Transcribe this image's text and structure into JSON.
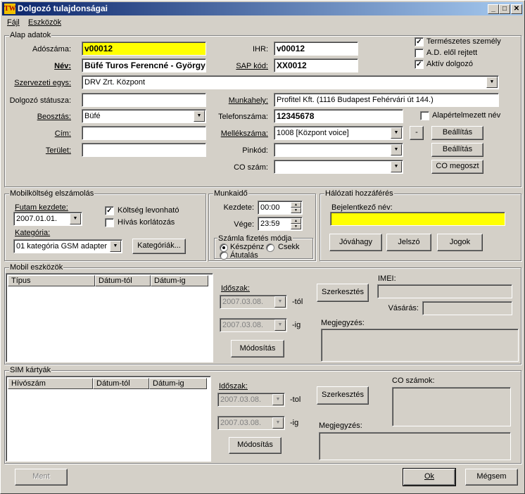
{
  "window": {
    "title": "Dolgozó tulajdonságai",
    "icon_text": "TW",
    "minimize": "_",
    "maximize": "□",
    "close": "✕"
  },
  "menu": {
    "file": "Fájl",
    "tools": "Eszközök"
  },
  "basic": {
    "group_title": "Alap adatok",
    "tax_label": "Adószáma:",
    "tax_value": "v00012",
    "name_label": "Név:",
    "name_value": "Büfé Turos Ferencné - György",
    "ihr_label": "IHR:",
    "ihr_value": "v00012",
    "sap_label": "SAP kód:",
    "sap_value": "XX0012",
    "natural_person": "Természetes személy",
    "ad_hidden": "A.D. elől rejtett",
    "active_employee": "Aktív dolgozó",
    "unit_label": "Szervezeti egys:",
    "unit_value": "DRV Zrt. Központ",
    "status_label": "Dolgozó státusza:",
    "status_value": "",
    "workplace_label": "Munkahely:",
    "workplace_value": "Profitel Kft. (1116 Budapest Fehérvári út 144.)",
    "position_label": "Beosztás:",
    "position_value": "Büfé",
    "phone_label": "Telefonszáma:",
    "phone_value": "12345678",
    "default_name": "Alapértelmezett név",
    "address_label": "Cím:",
    "address_value": "",
    "ext_label": "Mellékszáma:",
    "ext_value": "1008 [Központ voice]",
    "minus_button": "-",
    "settings_button": "Beállítás",
    "area_label": "Terület:",
    "area_value": "",
    "pin_label": "Pinkód:",
    "pin_value": "",
    "settings_button2": "Beállítás",
    "co_label": "CO szám:",
    "co_value": "",
    "co_share_button": "CO megoszt"
  },
  "mobile_cost": {
    "group_title": "Mobilköltség elszámolás",
    "run_label": "Futam kezdete:",
    "run_value": "2007.01.01.",
    "deductible": "Költség levonható",
    "call_limit": "Hívás korlátozás",
    "category_label": "Kategória:",
    "category_value": "01 kategória GSM adapter",
    "categories_button": "Kategóriák..."
  },
  "worktime": {
    "group_title": "Munkaidő",
    "start_label": "Kezdete:",
    "start_value": "00:00",
    "end_label": "Vége:",
    "end_value": "23:59",
    "payment_title": "Számla fizetés módja",
    "cash": "Készpénz",
    "check": "Csekk",
    "transfer": "Átutalás"
  },
  "network": {
    "group_title": "Hálózati hozzáférés",
    "login_label": "Bejelentkező név:",
    "login_value": "",
    "approve_button": "Jóváhagy",
    "password_button": "Jelszó",
    "rights_button": "Jogok"
  },
  "mobile_devices": {
    "group_title": "Mobil eszközök",
    "columns": [
      "Típus",
      "Dátum-tól",
      "Dátum-ig"
    ],
    "period_label": "Időszak:",
    "from_value": "2007.03.08.",
    "from_suffix": "-tól",
    "to_value": "2007.03.08.",
    "to_suffix": "-ig",
    "modify_button": "Módosítás",
    "edit_button": "Szerkesztés",
    "imei_label": "IMEI:",
    "imei_value": "",
    "purchase_label": "Vásárás:",
    "purchase_value": "",
    "note_label": "Megjegyzés:"
  },
  "sim_cards": {
    "group_title": "SIM kártyák",
    "columns": [
      "Hívószám",
      "Dátum-tól",
      "Dátum-ig"
    ],
    "period_label": "Időszak:",
    "from_value": "2007.03.08.",
    "from_suffix": "-tol",
    "to_value": "2007.03.08.",
    "to_suffix": "-ig",
    "modify_button": "Módosítás",
    "edit_button": "Szerkesztés",
    "co_numbers_label": "CO számok:",
    "note_label": "Megjegyzés:"
  },
  "footer": {
    "save_button": "Ment",
    "ok_button": "Ok",
    "cancel_button": "Mégsem"
  }
}
